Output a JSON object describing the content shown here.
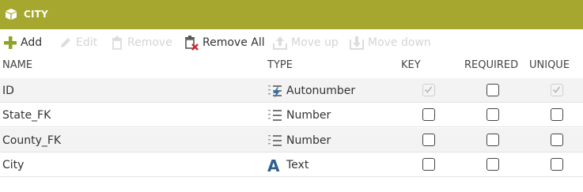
{
  "panel": {
    "title": "CITY",
    "accent_color": "#a6a72e"
  },
  "toolbar": {
    "add": "Add",
    "edit": "Edit",
    "remove": "Remove",
    "remove_all": "Remove All",
    "move_up": "Move up",
    "move_down": "Move down"
  },
  "columns": {
    "name": "NAME",
    "type": "TYPE",
    "key": "KEY",
    "required": "REQUIRED",
    "unique": "UNIQUE"
  },
  "rows": [
    {
      "name": "ID",
      "type": "Autonumber",
      "type_icon": "autonumber-icon",
      "key": true,
      "key_disabled": true,
      "required": false,
      "unique": true,
      "unique_disabled": true
    },
    {
      "name": "State_FK",
      "type": "Number",
      "type_icon": "number-icon",
      "key": false,
      "required": false,
      "unique": false
    },
    {
      "name": "County_FK",
      "type": "Number",
      "type_icon": "number-icon",
      "key": false,
      "required": false,
      "unique": false
    },
    {
      "name": "City",
      "type": "Text",
      "type_icon": "text-icon",
      "key": false,
      "required": false,
      "unique": false
    }
  ]
}
